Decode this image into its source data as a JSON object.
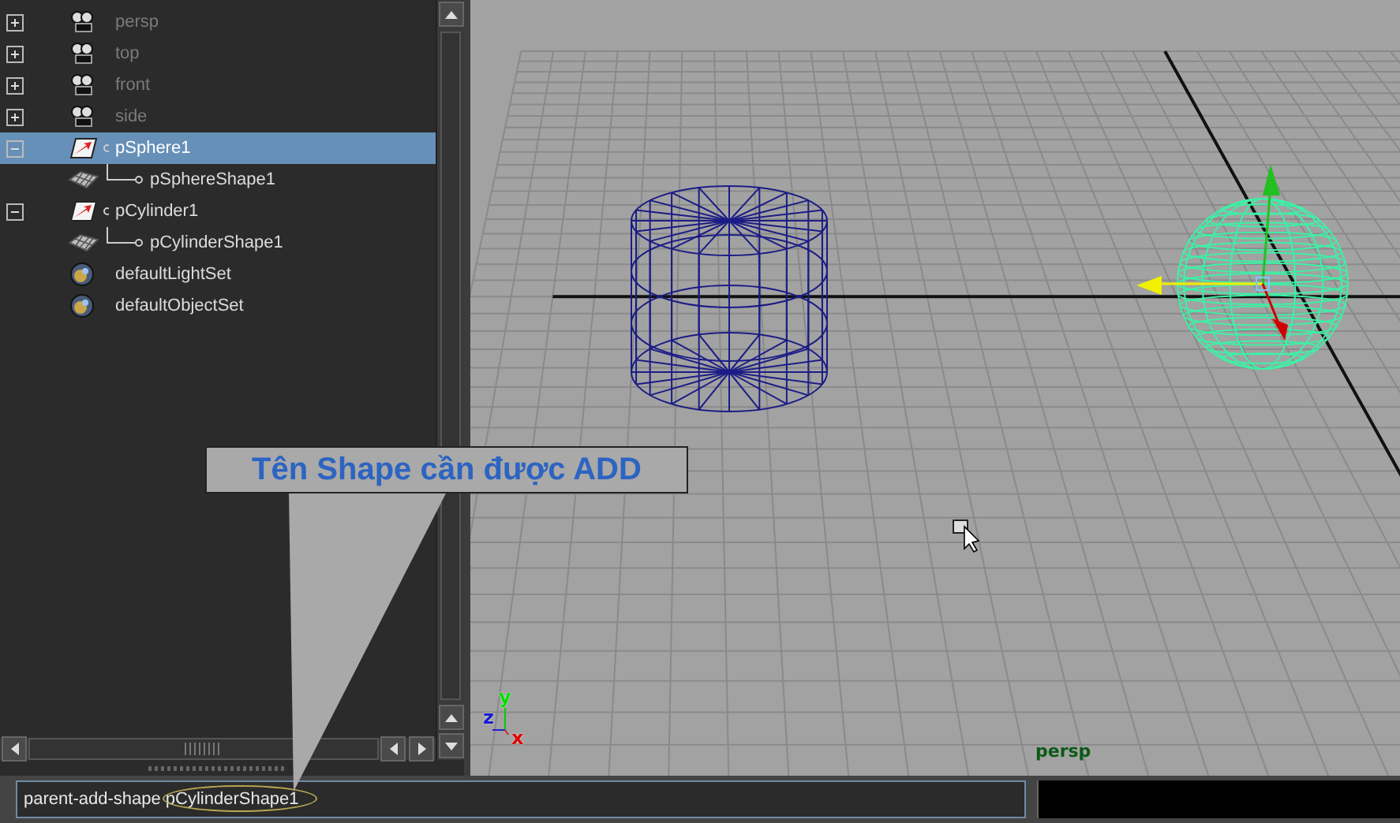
{
  "outliner": {
    "items": [
      {
        "kind": "camera",
        "label": "persp",
        "dimmed": true,
        "selected": false,
        "expanded": false
      },
      {
        "kind": "camera",
        "label": "top",
        "dimmed": true,
        "selected": false,
        "expanded": false
      },
      {
        "kind": "camera",
        "label": "front",
        "dimmed": true,
        "selected": false,
        "expanded": false
      },
      {
        "kind": "camera",
        "label": "side",
        "dimmed": true,
        "selected": false,
        "expanded": false
      },
      {
        "kind": "transform",
        "label": "pSphere1",
        "dimmed": false,
        "selected": true,
        "expanded": true,
        "children": [
          {
            "kind": "shape",
            "label": "pSphereShape1",
            "dimmed": false,
            "selected": false
          }
        ]
      },
      {
        "kind": "transform",
        "label": "pCylinder1",
        "dimmed": false,
        "selected": false,
        "expanded": true,
        "children": [
          {
            "kind": "shape",
            "label": "pCylinderShape1",
            "dimmed": false,
            "selected": false
          }
        ]
      },
      {
        "kind": "set",
        "label": "defaultLightSet",
        "dimmed": false,
        "selected": false
      },
      {
        "kind": "set",
        "label": "defaultObjectSet",
        "dimmed": false,
        "selected": false
      }
    ]
  },
  "viewport": {
    "axis_labels": [
      "y",
      "z",
      "x"
    ],
    "camera_label": "persp"
  },
  "callout": {
    "text": "Tên Shape cần được ADD"
  },
  "command_line": {
    "value": "parent-add-shape pCylinderShape1"
  }
}
